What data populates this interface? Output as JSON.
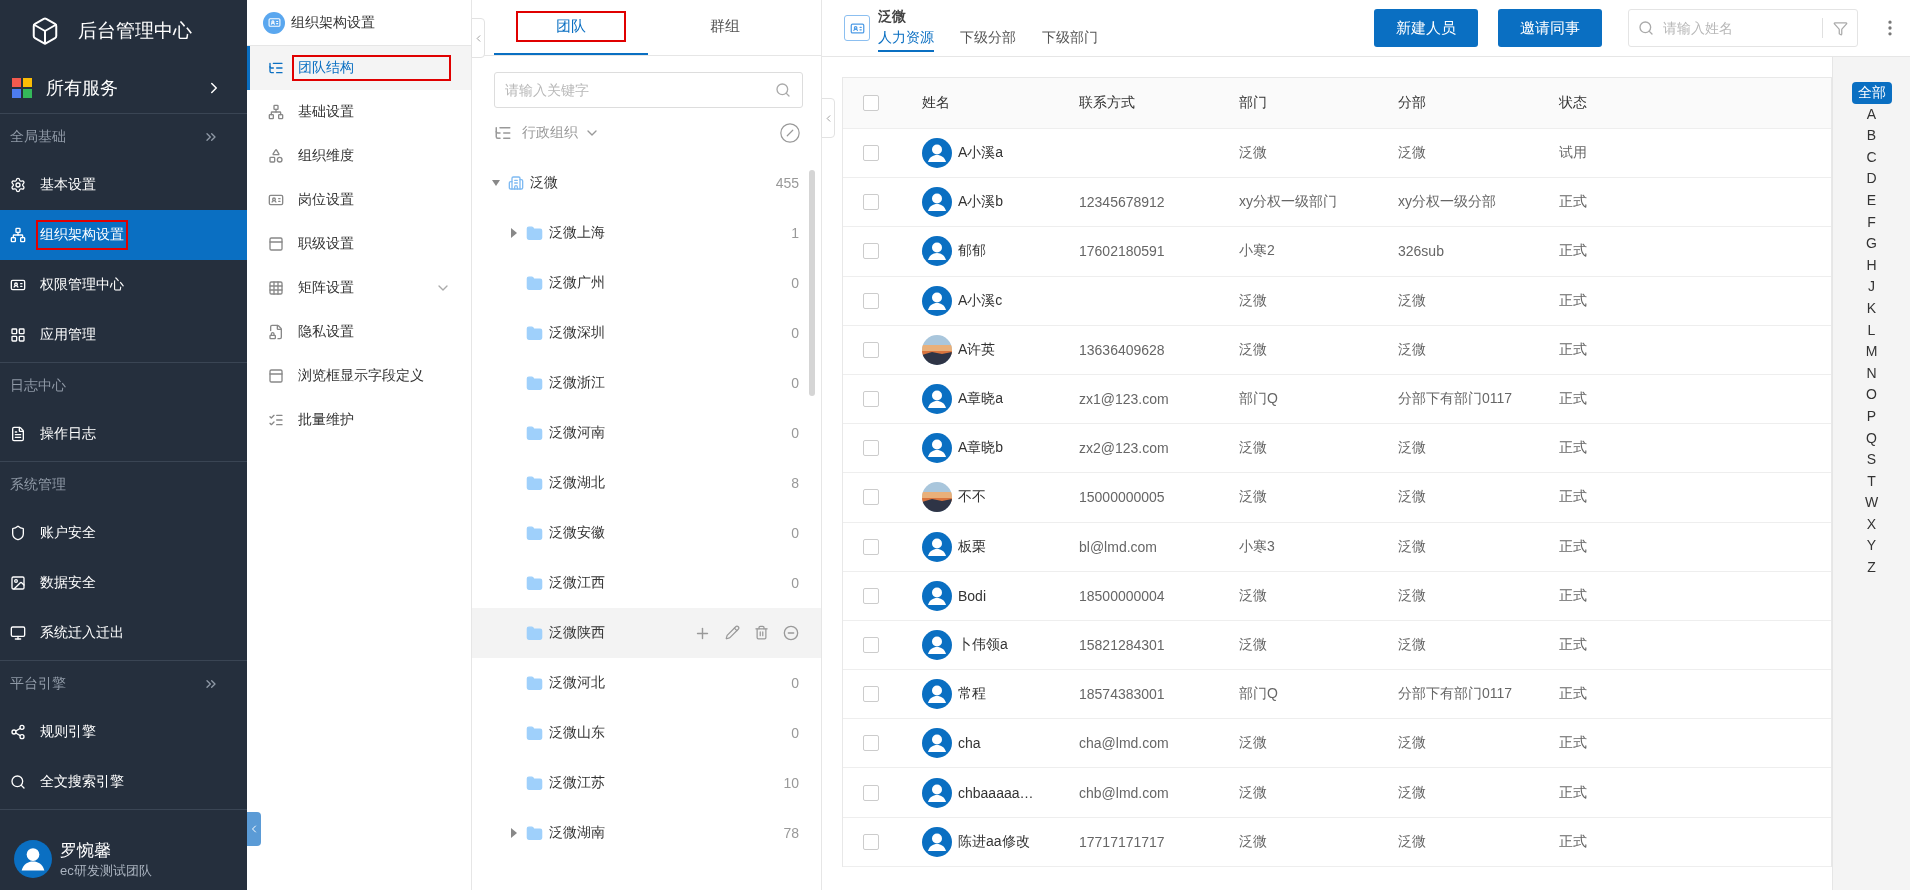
{
  "sidebar": {
    "brand": "后台管理中心",
    "all_services": "所有服务",
    "sections": [
      {
        "title": "全局基础",
        "collapsible": true,
        "items": [
          {
            "label": "基本设置",
            "selected": false,
            "highlighted": false
          },
          {
            "label": "组织架构设置",
            "selected": true,
            "highlighted": true
          },
          {
            "label": "权限管理中心",
            "selected": false,
            "highlighted": false
          },
          {
            "label": "应用管理",
            "selected": false,
            "highlighted": false
          }
        ]
      },
      {
        "title": "日志中心",
        "collapsible": false,
        "items": [
          {
            "label": "操作日志",
            "selected": false,
            "highlighted": false
          }
        ]
      },
      {
        "title": "系统管理",
        "collapsible": false,
        "items": [
          {
            "label": "账户安全",
            "selected": false,
            "highlighted": false
          },
          {
            "label": "数据安全",
            "selected": false,
            "highlighted": false
          },
          {
            "label": "系统迁入迁出",
            "selected": false,
            "highlighted": false
          }
        ]
      },
      {
        "title": "平台引擎",
        "collapsible": true,
        "items": [
          {
            "label": "规则引擎",
            "selected": false,
            "highlighted": false
          },
          {
            "label": "全文搜索引擎",
            "selected": false,
            "highlighted": false
          }
        ]
      }
    ],
    "user": {
      "name": "罗惋馨",
      "team": "ec研发测试团队"
    }
  },
  "submenu": {
    "title": "组织架构设置",
    "items": [
      {
        "label": "团队结构",
        "selected": true,
        "highlighted": true,
        "expandable": false
      },
      {
        "label": "基础设置",
        "selected": false,
        "highlighted": false,
        "expandable": false
      },
      {
        "label": "组织维度",
        "selected": false,
        "highlighted": false,
        "expandable": false
      },
      {
        "label": "岗位设置",
        "selected": false,
        "highlighted": false,
        "expandable": false
      },
      {
        "label": "职级设置",
        "selected": false,
        "highlighted": false,
        "expandable": false
      },
      {
        "label": "矩阵设置",
        "selected": false,
        "highlighted": false,
        "expandable": true
      },
      {
        "label": "隐私设置",
        "selected": false,
        "highlighted": false,
        "expandable": false
      },
      {
        "label": "浏览框显示字段定义",
        "selected": false,
        "highlighted": false,
        "expandable": false
      },
      {
        "label": "批量维护",
        "selected": false,
        "highlighted": false,
        "expandable": false
      }
    ]
  },
  "tree_panel": {
    "tabs": [
      {
        "label": "团队",
        "selected": true,
        "highlighted": true
      },
      {
        "label": "群组",
        "selected": false,
        "highlighted": false
      }
    ],
    "search": {
      "placeholder": "请输入关键字"
    },
    "dimension": "行政组织",
    "tree": {
      "label": "泛微",
      "count": "455",
      "expanded": true,
      "children": [
        {
          "label": "泛微上海",
          "count": "1",
          "has_children": true,
          "expanded": false,
          "hovered": false
        },
        {
          "label": "泛微广州",
          "count": "0",
          "has_children": false,
          "hovered": false
        },
        {
          "label": "泛微深圳",
          "count": "0",
          "has_children": false,
          "hovered": false
        },
        {
          "label": "泛微浙江",
          "count": "0",
          "has_children": false,
          "hovered": false
        },
        {
          "label": "泛微河南",
          "count": "0",
          "has_children": false,
          "hovered": false
        },
        {
          "label": "泛微湖北",
          "count": "8",
          "has_children": false,
          "hovered": false
        },
        {
          "label": "泛微安徽",
          "count": "0",
          "has_children": false,
          "hovered": false
        },
        {
          "label": "泛微江西",
          "count": "0",
          "has_children": false,
          "hovered": false
        },
        {
          "label": "泛微陕西",
          "has_children": false,
          "hovered": true
        },
        {
          "label": "泛微河北",
          "count": "0",
          "has_children": false,
          "hovered": false
        },
        {
          "label": "泛微山东",
          "count": "0",
          "has_children": false,
          "hovered": false
        },
        {
          "label": "泛微江苏",
          "count": "10",
          "has_children": false,
          "hovered": false
        },
        {
          "label": "泛微湖南",
          "count": "78",
          "has_children": true,
          "expanded": false,
          "hovered": false
        }
      ]
    }
  },
  "main": {
    "title": "泛微",
    "tabs": [
      {
        "label": "人力资源",
        "selected": true
      },
      {
        "label": "下级分部",
        "selected": false
      },
      {
        "label": "下级部门",
        "selected": false
      }
    ],
    "buttons": [
      "新建人员",
      "邀请同事"
    ],
    "search": {
      "placeholder": "请输入姓名"
    },
    "table": {
      "columns": [
        "姓名",
        "联系方式",
        "部门",
        "分部",
        "状态"
      ],
      "header_checked": false,
      "rows": [
        {
          "avatar": {
            "kind": "default"
          },
          "checked": false,
          "cells": [
            "A小溪a",
            "",
            "泛微",
            "泛微",
            "试用"
          ]
        },
        {
          "avatar": {
            "kind": "default"
          },
          "checked": false,
          "cells": [
            "A小溪b",
            "12345678912",
            "xy分权一级部门",
            "xy分权一级分部",
            "正式"
          ]
        },
        {
          "avatar": {
            "kind": "default"
          },
          "checked": false,
          "cells": [
            "郁郁",
            "17602180591",
            "小寒2",
            "326sub",
            "正式"
          ]
        },
        {
          "avatar": {
            "kind": "default"
          },
          "checked": false,
          "cells": [
            "A小溪c",
            "",
            "泛微",
            "泛微",
            "正式"
          ]
        },
        {
          "checked": false,
          "cells": [
            "A许英",
            "13636409628",
            "泛微",
            "泛微",
            "正式"
          ]
        },
        {
          "avatar": {
            "kind": "default"
          },
          "checked": false,
          "cells": [
            "A章晓a",
            "zx1@123.com",
            "部门Q",
            "分部下有部门0117",
            "正式"
          ]
        },
        {
          "avatar": {
            "kind": "default"
          },
          "checked": false,
          "cells": [
            "A章晓b",
            "zx2@123.com",
            "泛微",
            "泛微",
            "正式"
          ]
        },
        {
          "checked": false,
          "cells": [
            "不不",
            "15000000005",
            "泛微",
            "泛微",
            "正式"
          ]
        },
        {
          "avatar": {
            "kind": "default"
          },
          "checked": false,
          "cells": [
            "板栗",
            "bl@lmd.com",
            "小寒3",
            "泛微",
            "正式"
          ]
        },
        {
          "avatar": {
            "kind": "default"
          },
          "checked": false,
          "cells": [
            "Bodi",
            "18500000004",
            "泛微",
            "泛微",
            "正式"
          ]
        },
        {
          "avatar": {
            "kind": "default"
          },
          "checked": false,
          "cells": [
            "卜伟领a",
            "15821284301",
            "泛微",
            "泛微",
            "正式"
          ]
        },
        {
          "avatar": {
            "kind": "default"
          },
          "checked": false,
          "cells": [
            "常程",
            "18574383001",
            "部门Q",
            "分部下有部门0117",
            "正式"
          ]
        },
        {
          "avatar": {
            "kind": "default"
          },
          "checked": false,
          "cells": [
            "cha",
            "cha@lmd.com",
            "泛微",
            "泛微",
            "正式"
          ]
        },
        {
          "avatar": {
            "kind": "default"
          },
          "checked": false,
          "cells": [
            "chbaaaaa…",
            "chb@lmd.com",
            "泛微",
            "泛微",
            "正式"
          ]
        },
        {
          "avatar": {
            "kind": "default"
          },
          "checked": false,
          "cells": [
            "陈进aa修改",
            "17717171717",
            "泛微",
            "泛微",
            "正式"
          ]
        }
      ]
    },
    "alphabet": [
      {
        "label": "全部",
        "selected": true
      },
      {
        "label": "A",
        "selected": false
      },
      {
        "label": "B",
        "selected": false
      },
      {
        "label": "C",
        "selected": false
      },
      {
        "label": "D",
        "selected": false
      },
      {
        "label": "E",
        "selected": false
      },
      {
        "label": "F",
        "selected": false
      },
      {
        "label": "G",
        "selected": false
      },
      {
        "label": "H",
        "selected": false
      },
      {
        "label": "J",
        "selected": false
      },
      {
        "label": "K",
        "selected": false
      },
      {
        "label": "L",
        "selected": false
      },
      {
        "label": "M",
        "selected": false
      },
      {
        "label": "N",
        "selected": false
      },
      {
        "label": "O",
        "selected": false
      },
      {
        "label": "P",
        "selected": false
      },
      {
        "label": "Q",
        "selected": false
      },
      {
        "label": "S",
        "selected": false
      },
      {
        "label": "T",
        "selected": false
      },
      {
        "label": "W",
        "selected": false
      },
      {
        "label": "X",
        "selected": false
      },
      {
        "label": "Y",
        "selected": false
      },
      {
        "label": "Z",
        "selected": false
      }
    ]
  }
}
